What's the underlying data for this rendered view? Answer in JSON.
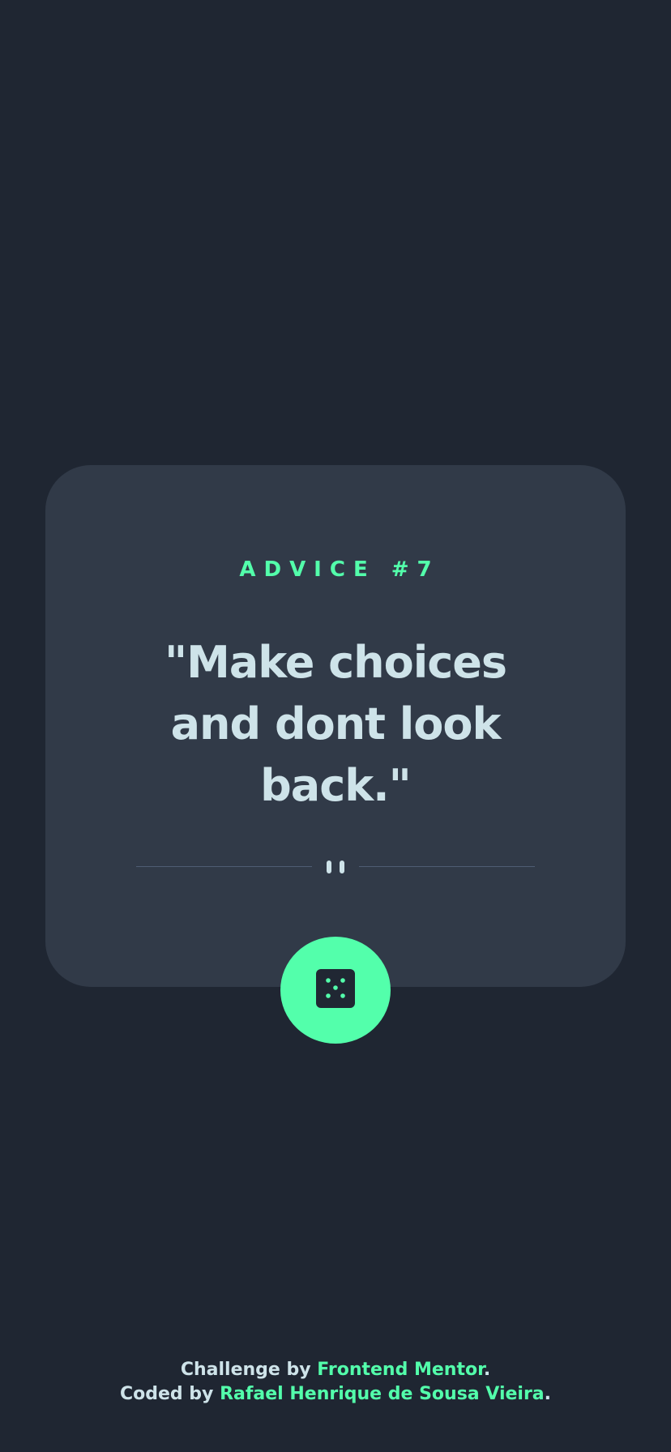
{
  "card": {
    "advice_label": "ADVICE #7",
    "quote": "\"Make choices and dont look back.\""
  },
  "dice_button": {
    "icon": "dice-icon"
  },
  "footer": {
    "challenge_prefix": "Challenge by ",
    "challenge_link": "Frontend Mentor",
    "challenge_suffix": ".",
    "coded_prefix": "Coded by ",
    "coded_link": "Rafael Henrique de Sousa Vieira",
    "coded_suffix": "."
  },
  "colors": {
    "background": "#1f2632",
    "card": "#313a48",
    "accent": "#53ffab",
    "text": "#cee3e9"
  }
}
